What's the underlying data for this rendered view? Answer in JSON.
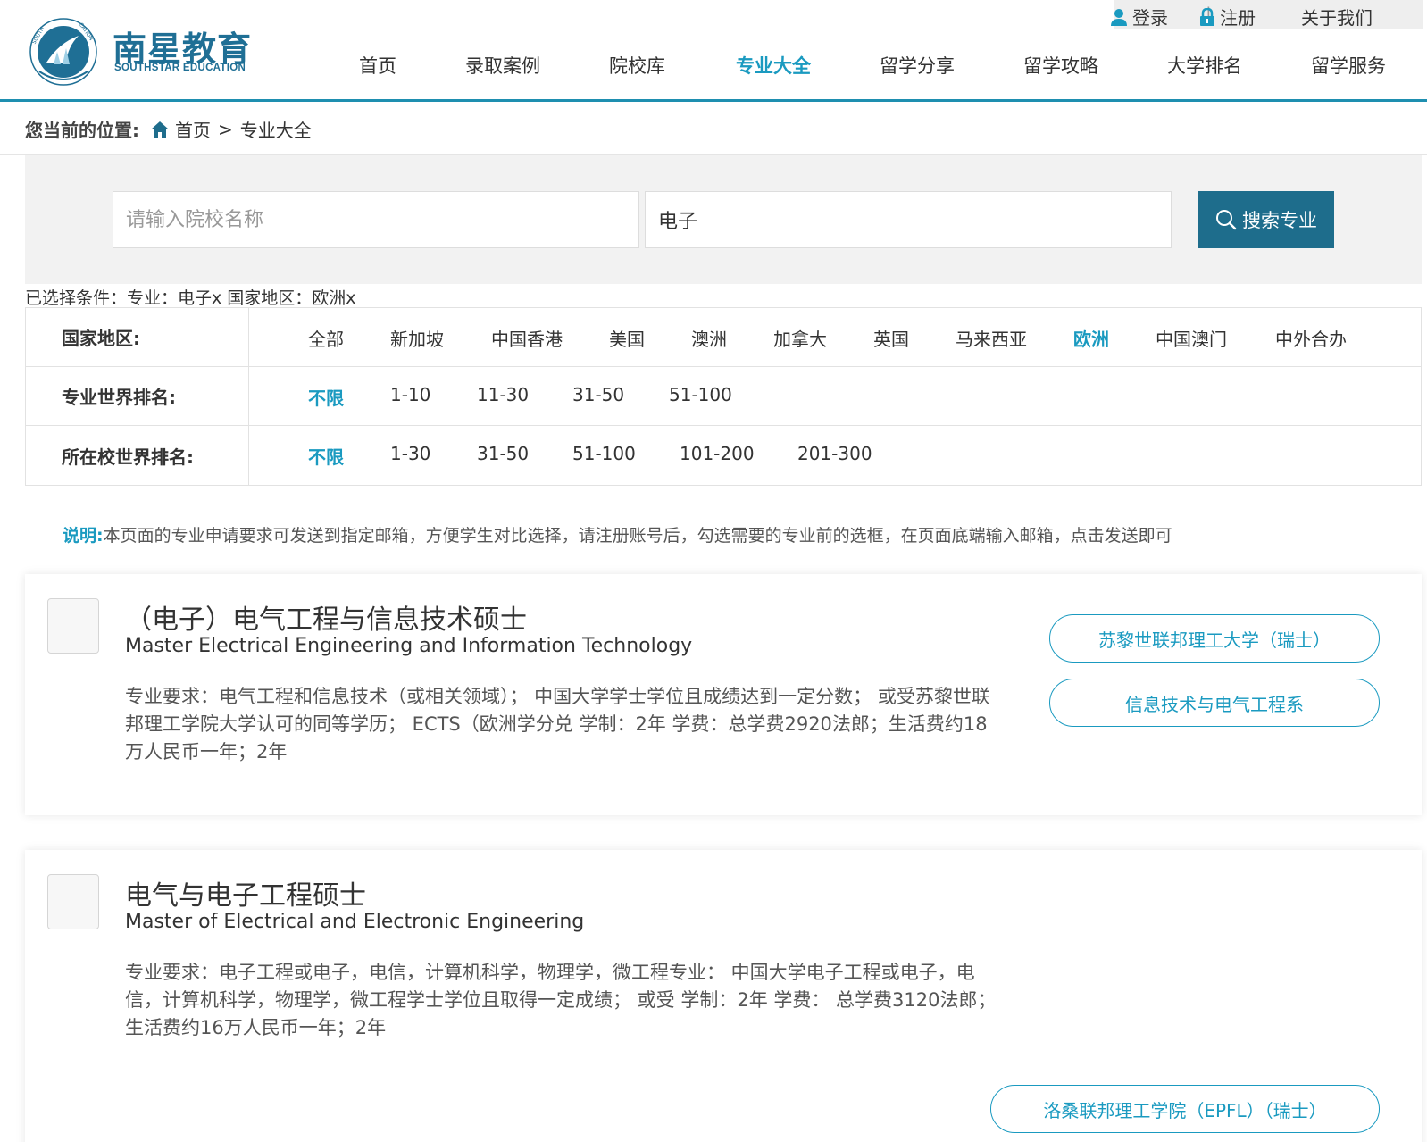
{
  "brand": {
    "name_cn": "南星教育",
    "name_en": "SOUTHSTAR EDUCATION",
    "colors": {
      "primary": "#1f6f95",
      "accent": "#1a9ac0",
      "button": "#1e6d8c"
    }
  },
  "topbar": {
    "login": "登录",
    "separator": "|",
    "register": "注册",
    "about": "关于我们",
    "login_icon": "user-icon",
    "register_icon": "lock-icon"
  },
  "nav": {
    "items": [
      "首页",
      "录取案例",
      "院校库",
      "专业大全",
      "留学分享",
      "留学攻略",
      "大学排名",
      "留学服务"
    ],
    "active": "专业大全"
  },
  "breadcrumb": {
    "label": "您当前的位置:",
    "home": "首页",
    "separator": ">",
    "current": "专业大全"
  },
  "search": {
    "school_placeholder": "请输入院校名称",
    "school_value": "",
    "major_value": "电子",
    "button_label": "搜索专业"
  },
  "selected_conditions": "已选择条件：专业：电子x 国家地区：欧洲x",
  "filters": {
    "region": {
      "label": "国家地区:",
      "options": [
        "全部",
        "新加坡",
        "中国香港",
        "美国",
        "澳洲",
        "加拿大",
        "英国",
        "马来西亚",
        "欧洲",
        "中国澳门",
        "中外合办"
      ],
      "active": "欧洲"
    },
    "major_rank": {
      "label": "专业世界排名:",
      "options": [
        "不限",
        "1-10",
        "11-30",
        "31-50",
        "51-100"
      ],
      "active": "不限"
    },
    "school_rank": {
      "label": "所在校世界排名:",
      "options": [
        "不限",
        "1-30",
        "31-50",
        "51-100",
        "101-200",
        "201-300"
      ],
      "active": "不限"
    }
  },
  "note": {
    "label": "说明:",
    "text": "本页面的专业申请要求可发送到指定邮箱，方便学生对比选择，请注册账号后，勾选需要的专业前的选框，在页面底端输入邮箱，点击发送即可"
  },
  "programs": [
    {
      "title_cn": "（电子）电气工程与信息技术硕士",
      "title_en": "Master Electrical Engineering and Information Technology",
      "requirements": "专业要求：电气工程和信息技术（或相关领域）；  中国大学学士学位且成绩达到一定分数；  或受苏黎世联邦理工学院大学认可的同等学历；  ECTS（欧洲学分兑 学制：2年 学费：总学费2920法郎；生活费约18万人民币一年；2年",
      "school": "苏黎世联邦理工大学（瑞士）",
      "department": "信息技术与电气工程系",
      "checked": false
    },
    {
      "title_cn": "电气与电子工程硕士",
      "title_en": "Master of Electrical and Electronic Engineering",
      "requirements": "专业要求：电子工程或电子，电信，计算机科学，物理学，微工程专业：  中国大学电子工程或电子，电信，计算机科学，物理学，微工程学士学位且取得一定成绩；  或受 学制：2年 学费：  总学费3120法郎；生活费约16万人民币一年；2年",
      "school": "洛桑联邦理工学院（EPFL）（瑞士）",
      "checked": false
    }
  ]
}
